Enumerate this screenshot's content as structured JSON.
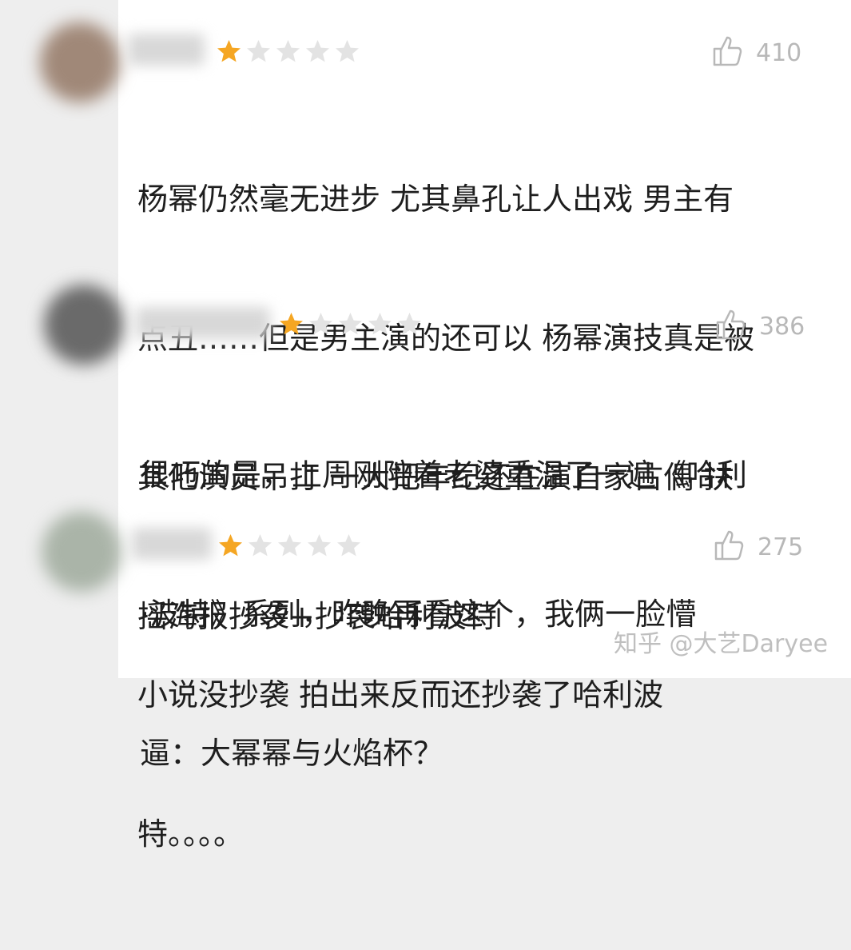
{
  "comments": [
    {
      "rating": 1,
      "max_rating": 5,
      "likes": "410",
      "lines": [
        "杨幂仍然毫无进步 尤其鼻孔让人出戏 男主有",
        "点丑……但是男主演的还可以 杨幂演技真是被",
        "其他演员吊打 一大把年纪还在演自家古偶 扶",
        "摇海报抄袭+抄袭哈利波特"
      ]
    },
    {
      "rating": 1,
      "max_rating": 5,
      "likes": "386",
      "lines": [
        "很巧的是，上周刚陪着老婆重温了一遍《哈利",
        "·波特》系列，昨晚再看这个，我俩一脸懵",
        "逼：大幂幂与火焰杯？"
      ]
    },
    {
      "rating": 1,
      "max_rating": 5,
      "likes": "275",
      "lines": [
        "小说没抄袭 拍出来反而还抄袭了哈利波",
        "特。。。。"
      ]
    }
  ],
  "icons": {
    "star": "star-icon",
    "like": "thumbs-up-icon"
  },
  "colors": {
    "star_filled": "#f5a623",
    "star_empty": "#e3e3e3",
    "like": "#b8b8b8",
    "text": "#1e1e1e"
  },
  "watermark": "知乎 @大艺Daryee"
}
